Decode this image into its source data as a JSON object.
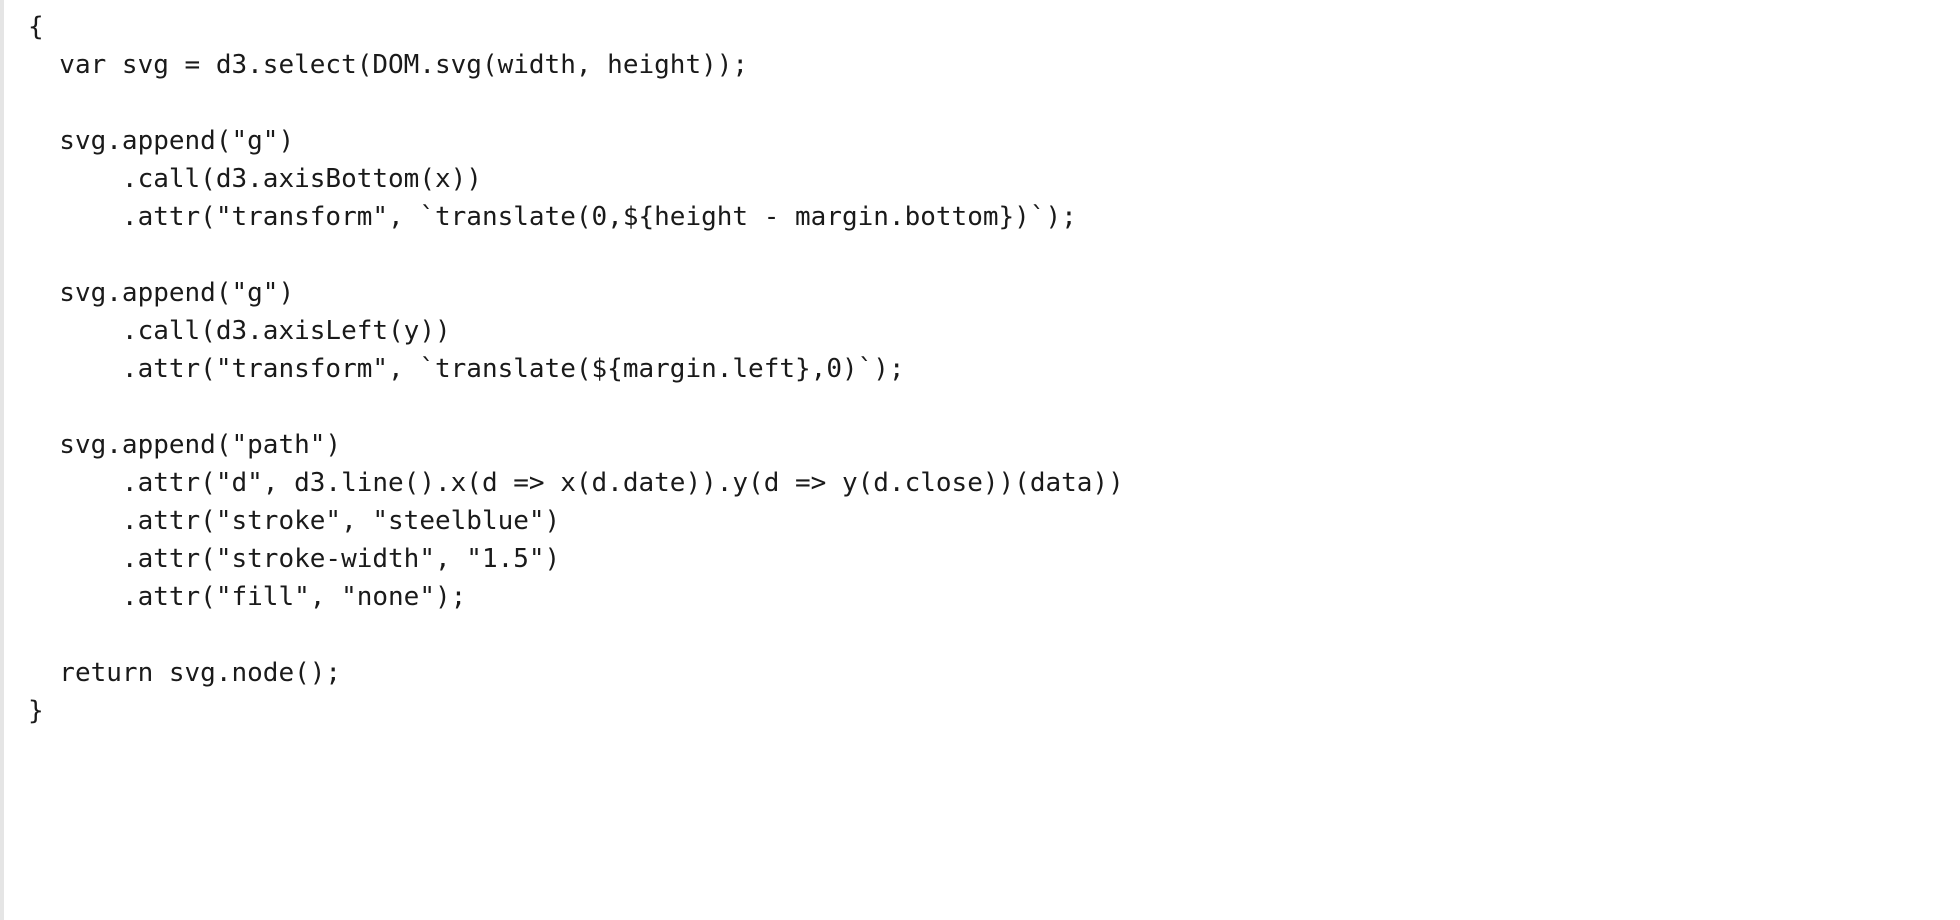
{
  "code": {
    "lines": [
      "{",
      "  var svg = d3.select(DOM.svg(width, height));",
      "",
      "  svg.append(\"g\")",
      "      .call(d3.axisBottom(x))",
      "      .attr(\"transform\", `translate(0,${height - margin.bottom})`);",
      "",
      "  svg.append(\"g\")",
      "      .call(d3.axisLeft(y))",
      "      .attr(\"transform\", `translate(${margin.left},0)`);",
      "",
      "  svg.append(\"path\")",
      "      .attr(\"d\", d3.line().x(d => x(d.date)).y(d => y(d.close))(data))",
      "      .attr(\"stroke\", \"steelblue\")",
      "      .attr(\"stroke-width\", \"1.5\")",
      "      .attr(\"fill\", \"none\");",
      "",
      "  return svg.node();",
      "}"
    ]
  }
}
